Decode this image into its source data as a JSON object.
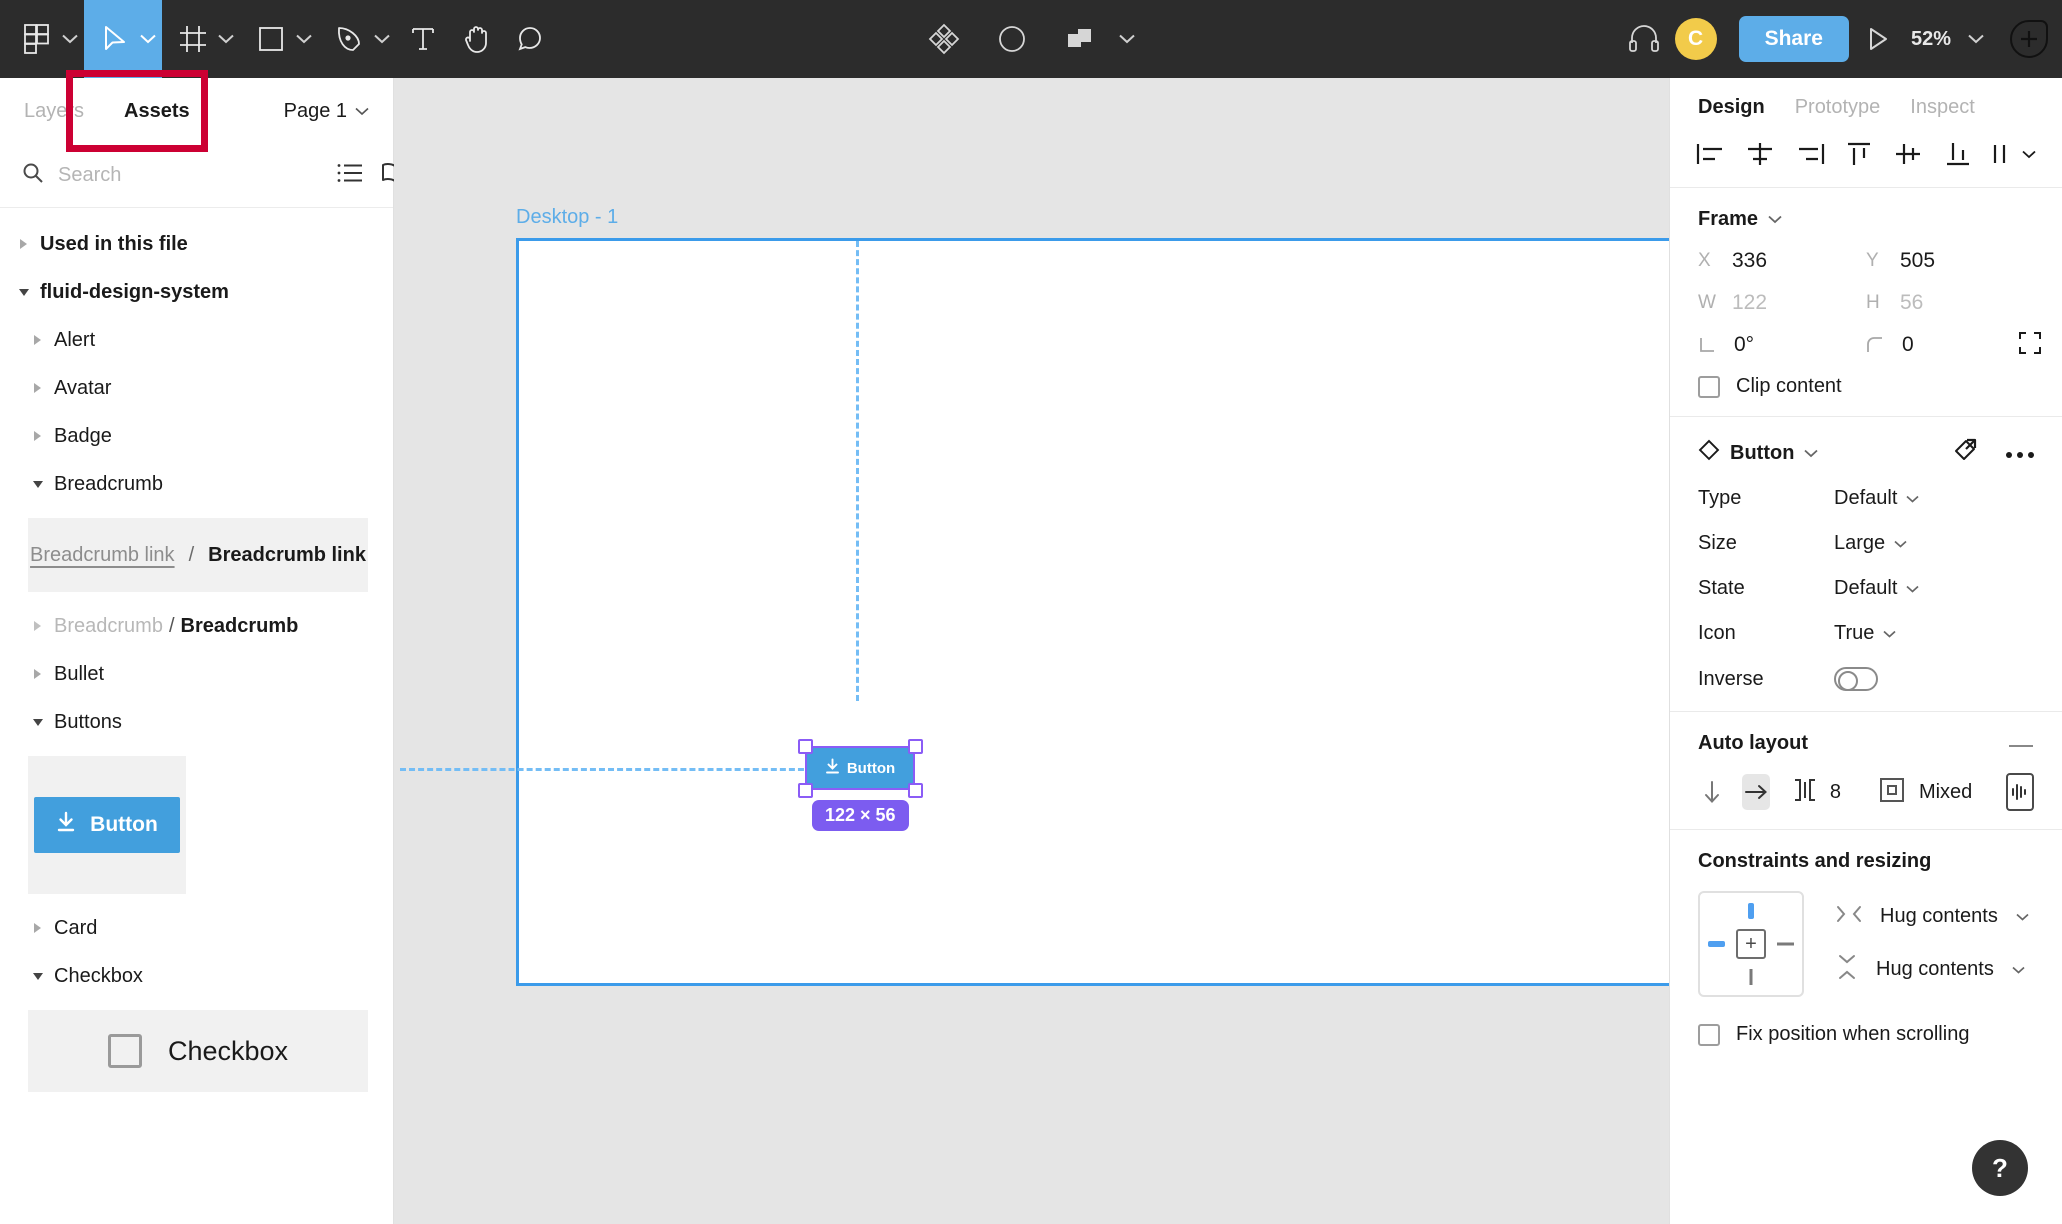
{
  "toolbar": {
    "left_tools": [
      {
        "name": "figma-menu-icon",
        "label": "Main menu",
        "dropdown": true,
        "active": false
      },
      {
        "name": "move-tool-icon",
        "label": "Move",
        "dropdown": true,
        "active": true
      },
      {
        "name": "frame-tool-icon",
        "label": "Frame",
        "dropdown": true,
        "active": false
      },
      {
        "name": "shape-tool-icon",
        "label": "Rectangle",
        "dropdown": true,
        "active": false
      },
      {
        "name": "pen-tool-icon",
        "label": "Pen",
        "dropdown": true,
        "active": false
      },
      {
        "name": "text-tool-icon",
        "label": "Text",
        "dropdown": false,
        "active": false
      },
      {
        "name": "hand-tool-icon",
        "label": "Hand",
        "dropdown": false,
        "active": false
      },
      {
        "name": "comment-tool-icon",
        "label": "Comment",
        "dropdown": false,
        "active": false
      }
    ],
    "center_tools": [
      {
        "name": "components-icon",
        "label": "Components",
        "dropdown": false
      },
      {
        "name": "mask-icon",
        "label": "Use as mask",
        "dropdown": false
      },
      {
        "name": "boolean-union-icon",
        "label": "Boolean groups",
        "dropdown": true
      }
    ],
    "observe_label": "Observation mode",
    "avatar_initial": "C",
    "avatar_color": "#f2cb4a",
    "share_label": "Share",
    "present_label": "Present",
    "zoom_level": "52%",
    "accent_color": "#5dade8"
  },
  "left_panel": {
    "tabs": [
      {
        "label": "Layers",
        "active": false
      },
      {
        "label": "Assets",
        "active": true
      }
    ],
    "page_selector": "Page 1",
    "search": {
      "value": "",
      "placeholder": "Search"
    },
    "view_list_icon": "list-view-icon",
    "view_grid_icon": "library-book-icon",
    "sections": [
      {
        "kind": "group",
        "label": "Used in this file",
        "expanded": false,
        "level": 0
      },
      {
        "kind": "group",
        "label": "fluid-design-system",
        "expanded": true,
        "level": 0
      },
      {
        "kind": "item",
        "label": "Alert",
        "expanded": false,
        "level": 1
      },
      {
        "kind": "item",
        "label": "Avatar",
        "expanded": false,
        "level": 1
      },
      {
        "kind": "item",
        "label": "Badge",
        "expanded": false,
        "level": 1
      },
      {
        "kind": "item",
        "label": "Breadcrumb",
        "expanded": true,
        "level": 1
      },
      {
        "kind": "preview-breadcrumb"
      },
      {
        "kind": "item-breadcrumb",
        "prefix": "Breadcrumb",
        "separator": "/",
        "suffix": "Breadcrumb",
        "expanded": false,
        "level": 1
      },
      {
        "kind": "item",
        "label": "Bullet",
        "expanded": false,
        "level": 1
      },
      {
        "kind": "item",
        "label": "Buttons",
        "expanded": true,
        "level": 1
      },
      {
        "kind": "preview-button"
      },
      {
        "kind": "item",
        "label": "Card",
        "expanded": false,
        "level": 1
      },
      {
        "kind": "item",
        "label": "Checkbox",
        "expanded": true,
        "level": 1
      },
      {
        "kind": "preview-checkbox"
      }
    ],
    "breadcrumb_preview": {
      "link_label": "Breadcrumb link",
      "separator": "/",
      "current_label": "Breadcrumb link"
    },
    "button_preview": {
      "label": "Button",
      "icon": "download-icon",
      "color": "#429fdd"
    },
    "checkbox_preview": {
      "label": "Checkbox",
      "checked": false
    }
  },
  "annotation": {
    "color": "#cc0033",
    "target": "assets-tab"
  },
  "canvas": {
    "frame_label": "Desktop - 1",
    "selection": {
      "label": "Button",
      "icon": "download-icon",
      "size_badge": "122 × 56",
      "badge_color": "#7c5cf0",
      "fill_color": "#429fdd"
    },
    "background_color": "#e5e5e5",
    "frame_border_color": "#3b9bea"
  },
  "right_panel": {
    "tabs": [
      {
        "label": "Design",
        "active": true
      },
      {
        "label": "Prototype",
        "active": false
      },
      {
        "label": "Inspect",
        "active": false
      }
    ],
    "align_buttons": [
      {
        "name": "align-left-icon",
        "label": "Align left"
      },
      {
        "name": "align-horizontal-center-icon",
        "label": "Align horizontal centers"
      },
      {
        "name": "align-right-icon",
        "label": "Align right"
      },
      {
        "name": "align-top-icon",
        "label": "Align top"
      },
      {
        "name": "align-vertical-center-icon",
        "label": "Align vertical centers"
      },
      {
        "name": "align-bottom-icon",
        "label": "Align bottom"
      },
      {
        "name": "distribute-icon",
        "label": "Distribute",
        "dropdown": true
      }
    ],
    "frame": {
      "title": "Frame",
      "x_key": "X",
      "x_value": "336",
      "y_key": "Y",
      "y_value": "505",
      "w_key": "W",
      "w_value": "122",
      "h_key": "H",
      "h_value": "56",
      "rotation_value": "0°",
      "corner_radius_value": "0",
      "independent_corners_icon": "independent-corners-icon",
      "clip_content_label": "Clip content",
      "clip_content_checked": false
    },
    "component": {
      "name": "Button",
      "swap_icon": "swap-instance-icon",
      "more_icon": "more-options-icon",
      "properties": [
        {
          "name": "Type",
          "value": "Default",
          "type": "select"
        },
        {
          "name": "Size",
          "value": "Large",
          "type": "select"
        },
        {
          "name": "State",
          "value": "Default",
          "type": "select"
        },
        {
          "name": "Icon",
          "value": "True",
          "type": "select"
        },
        {
          "name": "Inverse",
          "value": "off",
          "type": "toggle"
        }
      ]
    },
    "auto_layout": {
      "title": "Auto layout",
      "collapse_icon": "minus-icon",
      "direction_vertical_icon": "arrow-down-icon",
      "direction_horizontal_icon": "arrow-right-icon",
      "direction_selected": "horizontal",
      "gap_icon": "gap-icon",
      "gap_value": "8",
      "padding_icon": "padding-icon",
      "padding_value": "Mixed",
      "advanced_icon": "advanced-layout-icon"
    },
    "constraints": {
      "title": "Constraints and resizing",
      "horizontal_constraint": "left",
      "vertical_constraint": "top",
      "resize_horizontal_icon": "resize-horizontal-icon",
      "resize_horizontal_value": "Hug contents",
      "resize_vertical_icon": "resize-vertical-icon",
      "resize_vertical_value": "Hug contents",
      "fix_position_label": "Fix position when scrolling",
      "fix_position_checked": false
    },
    "help_label": "?"
  }
}
